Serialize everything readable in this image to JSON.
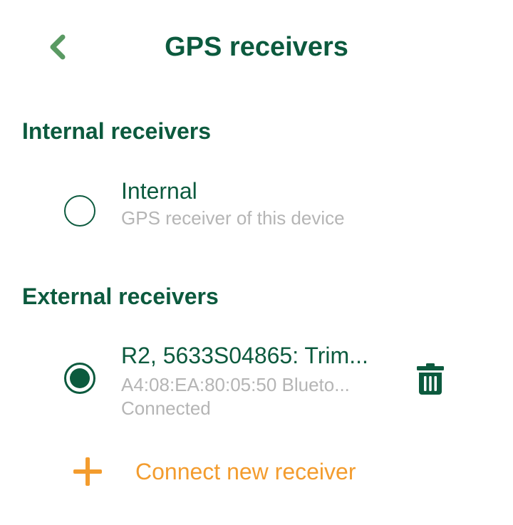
{
  "header": {
    "title": "GPS receivers"
  },
  "sections": {
    "internal": {
      "heading": "Internal receivers",
      "receiver": {
        "name": "Internal",
        "description": "GPS receiver of this device",
        "selected": false
      }
    },
    "external": {
      "heading": "External receivers",
      "receiver": {
        "name": "R2, 5633S04865: Trim...",
        "address_line": "A4:08:EA:80:05:50  Blueto...",
        "status": "Connected",
        "selected": true
      }
    }
  },
  "actions": {
    "connect_new_label": "Connect new receiver"
  },
  "colors": {
    "primary": "#0c5a3e",
    "back_arrow": "#5a9a63",
    "accent": "#f39c2e",
    "secondary_text": "#b5b5b5"
  },
  "icons": {
    "back": "chevron-left-icon",
    "delete": "trash-icon",
    "add": "plus-icon"
  }
}
